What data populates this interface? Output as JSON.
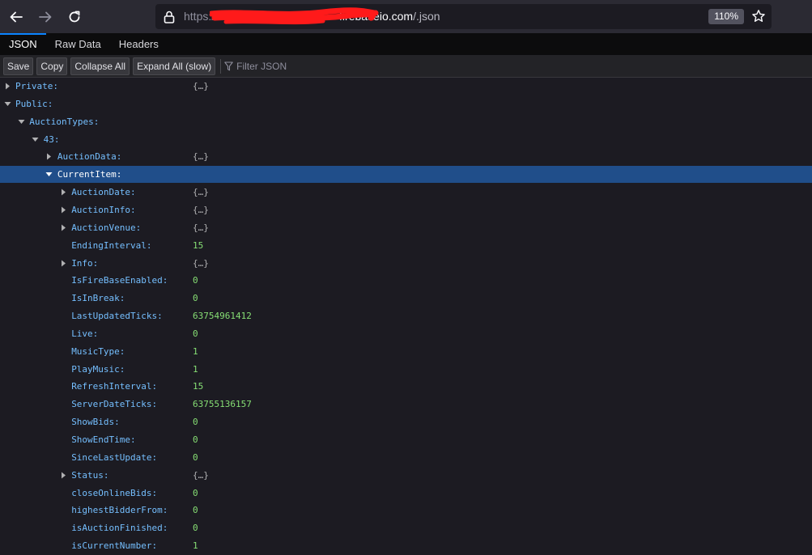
{
  "browser": {
    "url_scheme": "https://",
    "url_domain": "firebaseio.com",
    "url_path": "/.json",
    "zoom": "110%"
  },
  "tabs": [
    {
      "label": "JSON",
      "active": true
    },
    {
      "label": "Raw Data",
      "active": false
    },
    {
      "label": "Headers",
      "active": false
    }
  ],
  "buttons": {
    "save": "Save",
    "copy": "Copy",
    "collapse_all": "Collapse All",
    "expand_all": "Expand All (slow)",
    "filter_placeholder": "Filter JSON"
  },
  "colors": {
    "accent": "#0a84ff",
    "selected_row": "#204e8a",
    "key": "#75bfff",
    "number": "#86de74",
    "object": "#b1b1b3"
  },
  "tree": [
    {
      "key": "Private:",
      "value": "{…}",
      "type": "obj",
      "depth": 0,
      "twisty": "collapsed"
    },
    {
      "key": "Public:",
      "value": "",
      "type": "",
      "depth": 0,
      "twisty": "expanded"
    },
    {
      "key": "AuctionTypes:",
      "value": "",
      "type": "",
      "depth": 1,
      "twisty": "expanded"
    },
    {
      "key": "43:",
      "value": "",
      "type": "",
      "depth": 2,
      "twisty": "expanded"
    },
    {
      "key": "AuctionData:",
      "value": "{…}",
      "type": "obj",
      "depth": 3,
      "twisty": "collapsed"
    },
    {
      "key": "CurrentItem:",
      "value": "",
      "type": "",
      "depth": 3,
      "twisty": "expanded",
      "selected": true
    },
    {
      "key": "AuctionDate:",
      "value": "{…}",
      "type": "obj",
      "depth": 4,
      "twisty": "collapsed"
    },
    {
      "key": "AuctionInfo:",
      "value": "{…}",
      "type": "obj",
      "depth": 4,
      "twisty": "collapsed"
    },
    {
      "key": "AuctionVenue:",
      "value": "{…}",
      "type": "obj",
      "depth": 4,
      "twisty": "collapsed"
    },
    {
      "key": "EndingInterval:",
      "value": "15",
      "type": "num",
      "depth": 4,
      "twisty": "none"
    },
    {
      "key": "Info:",
      "value": "{…}",
      "type": "obj",
      "depth": 4,
      "twisty": "collapsed"
    },
    {
      "key": "IsFireBaseEnabled:",
      "value": "0",
      "type": "num",
      "depth": 4,
      "twisty": "none"
    },
    {
      "key": "IsInBreak:",
      "value": "0",
      "type": "num",
      "depth": 4,
      "twisty": "none"
    },
    {
      "key": "LastUpdatedTicks:",
      "value": "63754961412",
      "type": "num",
      "depth": 4,
      "twisty": "none"
    },
    {
      "key": "Live:",
      "value": "0",
      "type": "num",
      "depth": 4,
      "twisty": "none"
    },
    {
      "key": "MusicType:",
      "value": "1",
      "type": "num",
      "depth": 4,
      "twisty": "none"
    },
    {
      "key": "PlayMusic:",
      "value": "1",
      "type": "num",
      "depth": 4,
      "twisty": "none"
    },
    {
      "key": "RefreshInterval:",
      "value": "15",
      "type": "num",
      "depth": 4,
      "twisty": "none"
    },
    {
      "key": "ServerDateTicks:",
      "value": "63755136157",
      "type": "num",
      "depth": 4,
      "twisty": "none"
    },
    {
      "key": "ShowBids:",
      "value": "0",
      "type": "num",
      "depth": 4,
      "twisty": "none"
    },
    {
      "key": "ShowEndTime:",
      "value": "0",
      "type": "num",
      "depth": 4,
      "twisty": "none"
    },
    {
      "key": "SinceLastUpdate:",
      "value": "0",
      "type": "num",
      "depth": 4,
      "twisty": "none"
    },
    {
      "key": "Status:",
      "value": "{…}",
      "type": "obj",
      "depth": 4,
      "twisty": "collapsed"
    },
    {
      "key": "closeOnlineBids:",
      "value": "0",
      "type": "num",
      "depth": 4,
      "twisty": "none"
    },
    {
      "key": "highestBidderFrom:",
      "value": "0",
      "type": "num",
      "depth": 4,
      "twisty": "none"
    },
    {
      "key": "isAuctionFinished:",
      "value": "0",
      "type": "num",
      "depth": 4,
      "twisty": "none"
    },
    {
      "key": "isCurrentNumber:",
      "value": "1",
      "type": "num",
      "depth": 4,
      "twisty": "none"
    }
  ]
}
